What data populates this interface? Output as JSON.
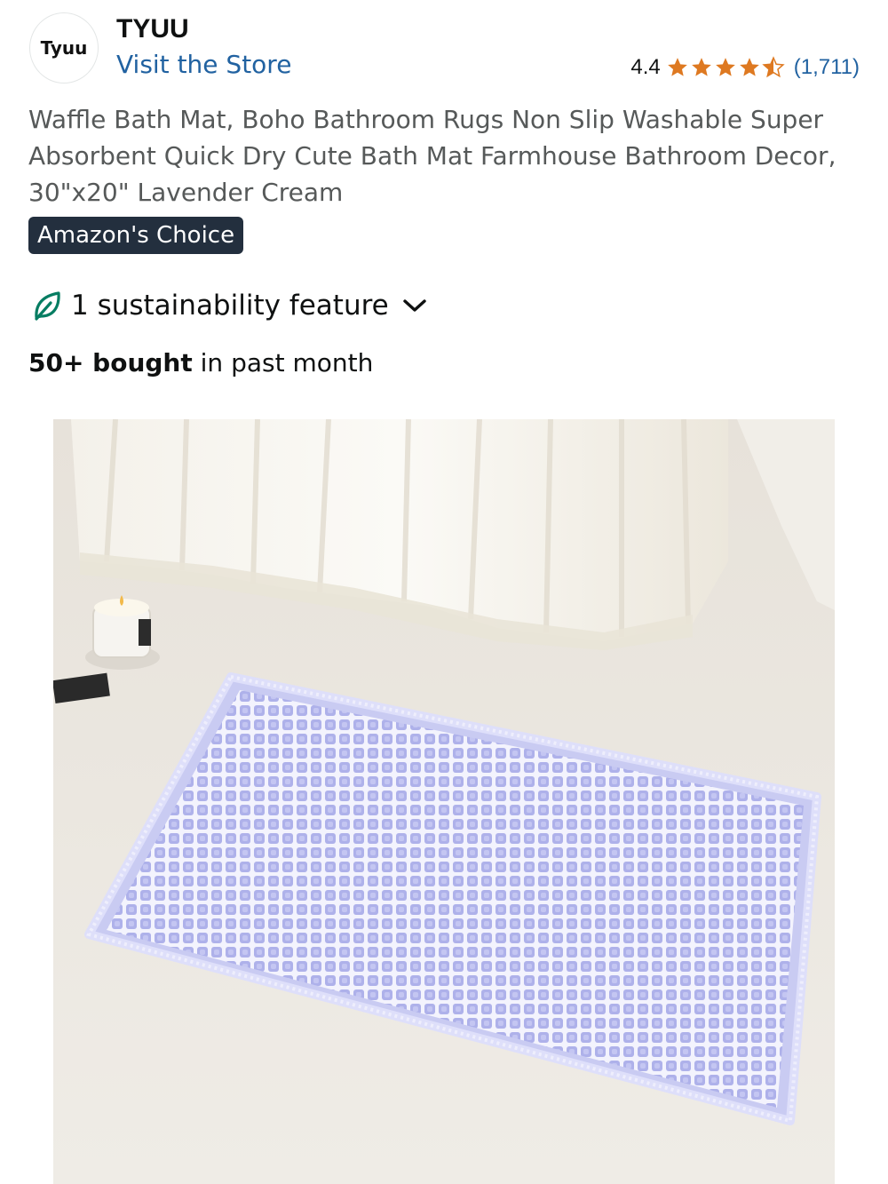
{
  "brand": {
    "logo_text": "Tyuu",
    "name": "TYUU",
    "visit_store": "Visit the Store"
  },
  "rating": {
    "value": "4.4",
    "stars": 4.5,
    "count": "(1,711)",
    "star_color": "#de7921"
  },
  "product": {
    "title": "Waffle Bath Mat, Boho Bathroom Rugs Non Slip Washable Super Absorbent Quick Dry Cute Bath Mat Farmhouse Bathroom Decor, 30\"x20\" Lavender Cream",
    "badge": "Amazon's Choice",
    "sustainability": "1 sustainability feature",
    "bought_bold": "50+ bought",
    "bought_rest": " in past month"
  },
  "icons": {
    "leaf": "leaf-icon",
    "chevron": "chevron-down-icon",
    "star": "star-icon"
  },
  "colors": {
    "link": "#2162a1",
    "badge_bg": "#232f3e",
    "leaf": "#067d62",
    "mat": "#b7b9ec"
  }
}
